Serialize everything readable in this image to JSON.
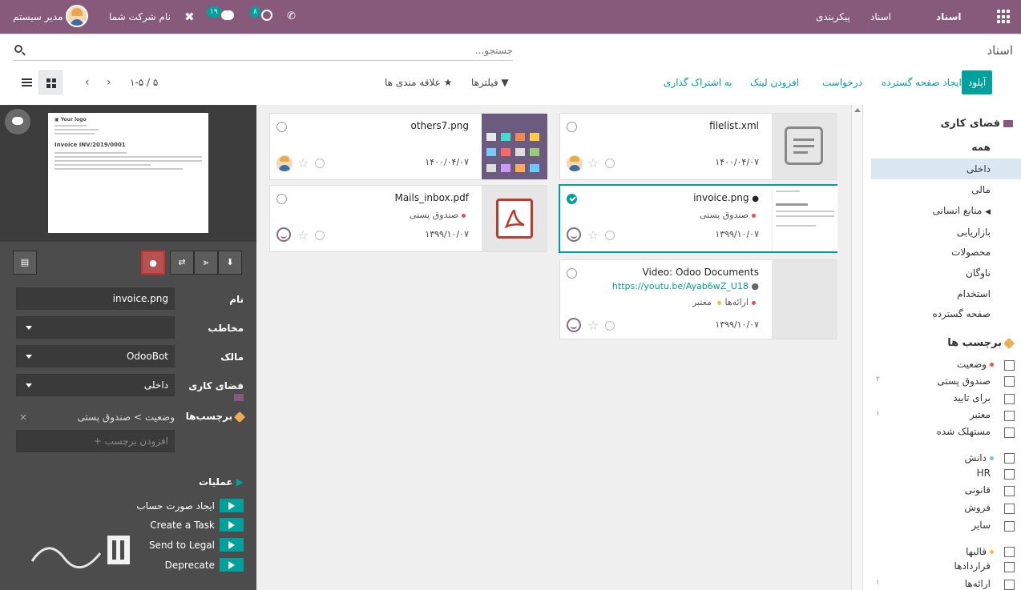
{
  "navbar": {
    "brand": "اسناد",
    "menu": [
      "اسناد",
      "پیکربندی"
    ],
    "user": "مدیر سیستم",
    "company": "نام شرکت شما",
    "activity_count": "۸",
    "message_count": "۱۹"
  },
  "control": {
    "breadcrumb": "اسناد",
    "search_placeholder": "جستجو...",
    "buttons": {
      "upload": "آپلود",
      "spreadsheet": "ایجاد صفحه گسترده",
      "request": "درخواست",
      "add_link": "افزودن لینک",
      "share": "به اشتراک گذاری"
    },
    "filters": "فیلترها",
    "favorites": "علاقه مندی ها",
    "pager": "۱-۵ / ۵"
  },
  "inspector": {
    "thumb_logo": "Your logo",
    "thumb_title": "Invoice INV/2019/0001",
    "fields": {
      "name_label": "نام",
      "name_value": "invoice.png",
      "contact_label": "مخاطب",
      "contact_value": "",
      "owner_label": "مالک",
      "owner_value": "OdooBot",
      "workspace_label": "فضای کاری",
      "workspace_value": "داخلی",
      "tags_label": "برچسب‌ها",
      "tag_value": "وضعیت > صندوق پستی",
      "tag_remove": "×",
      "add_tag": "+ افزودن برچسب"
    },
    "ops_title": "عملیات",
    "operations": [
      "ایجاد صورت حساب",
      "Create a Task",
      "Send to Legal",
      "Deprecate"
    ]
  },
  "cards": [
    {
      "title": "filelist.xml",
      "date": "۱۴۰۰/۰۴/۰۷"
    },
    {
      "title": "others7.png",
      "date": "۱۴۰۰/۰۴/۰۷"
    },
    {
      "title": "invoice.png",
      "tag": "صندوق پستی",
      "date": "۱۳۹۹/۱۰/۰۷"
    },
    {
      "title": "Mails_inbox.pdf",
      "tag": "صندوق پستی",
      "date": "۱۳۹۹/۱۰/۰۷"
    },
    {
      "title": "Video: Odoo Documents",
      "url": "https://youtu.be/Ayab6wZ_U18",
      "tag1": "معتبر",
      "tag2": "ارائه‌ها",
      "date": "۱۳۹۹/۱۰/۰۷"
    }
  ],
  "sidebar": {
    "workspace_title": "فضای کاری",
    "workspaces": [
      "همه",
      "داخلی",
      "مالی",
      "منابع انسانی",
      "بازاریابی",
      "محصولات",
      "ناوگان",
      "استخدام",
      "صفحه گسترده"
    ],
    "tags_title": "برچسب ها",
    "status_title": "وضعیت",
    "status_items": [
      {
        "label": "صندوق پستی",
        "count": "۲"
      },
      {
        "label": "برای تایید",
        "count": ""
      },
      {
        "label": "معتبر",
        "count": "۱"
      },
      {
        "label": "مستهلک شده",
        "count": ""
      }
    ],
    "knowledge_title": "دانش",
    "knowledge_items": [
      "HR",
      "قانونی",
      "فروش",
      "سایر"
    ],
    "templates_title": "قالبها",
    "template_items": [
      {
        "label": "قراردادها",
        "count": ""
      },
      {
        "label": "ارائه‌ها",
        "count": "۱"
      }
    ]
  },
  "colors": {
    "brand": "#875a7b",
    "accent": "#00a09d",
    "panel": "#4c4c4c",
    "danger": "#c9302c"
  },
  "icons": [
    "apps-grid-icon",
    "phone-icon",
    "clock-icon",
    "chat-icon",
    "tools-icon",
    "search-icon",
    "kanban-view-icon",
    "list-view-icon",
    "lock-icon",
    "share-icon",
    "download-icon",
    "replace-icon",
    "archive-icon",
    "play-icon",
    "star-icon",
    "pdf-icon",
    "globe-icon"
  ]
}
